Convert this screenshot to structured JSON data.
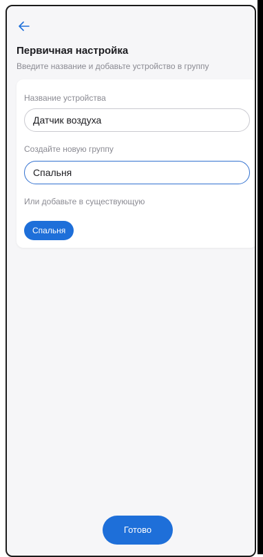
{
  "header": {
    "title": "Первичная настройка",
    "subtitle": "Введите название и добавьте устройство в группу"
  },
  "form": {
    "device_name_label": "Название устройства",
    "device_name_value": "Датчик воздуха",
    "new_group_label": "Создайте новую группу",
    "new_group_value": "Спальня",
    "existing_group_label": "Или добавьте в существующую",
    "existing_groups": [
      "Спальня"
    ]
  },
  "footer": {
    "done_label": "Готово"
  },
  "colors": {
    "accent": "#1e6fd9",
    "background": "#f6f6f8",
    "card": "#ffffff"
  },
  "icons": {
    "back": "arrow-left-icon"
  }
}
